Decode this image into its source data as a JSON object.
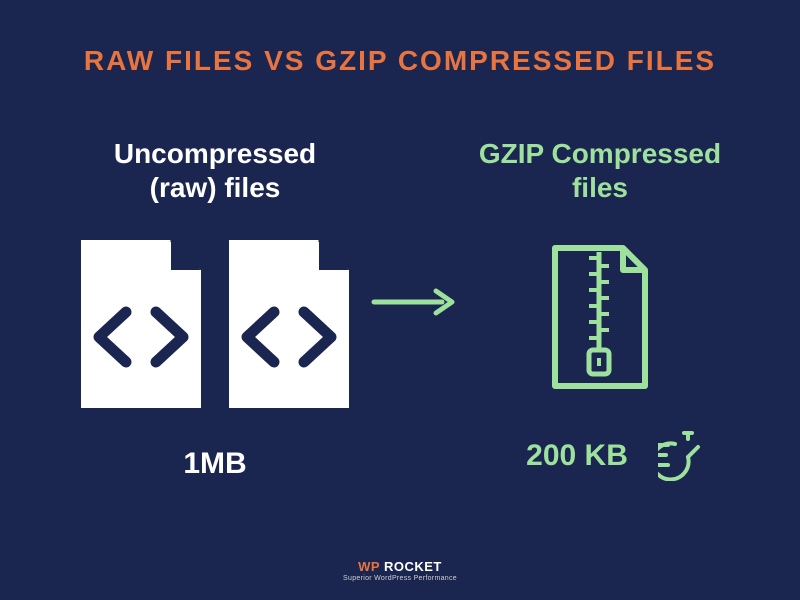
{
  "title": "RAW FILES VS GZIP COMPRESSED FILES",
  "left": {
    "label_line1": "Uncompressed",
    "label_line2": "(raw) files",
    "size": "1MB"
  },
  "right": {
    "label_line1": "GZIP Compressed",
    "label_line2": "files",
    "size": "200 KB"
  },
  "footer": {
    "brand_wp": "WP",
    "brand_rocket": " ROCKET",
    "tagline": "Superior WordPress Performance"
  }
}
